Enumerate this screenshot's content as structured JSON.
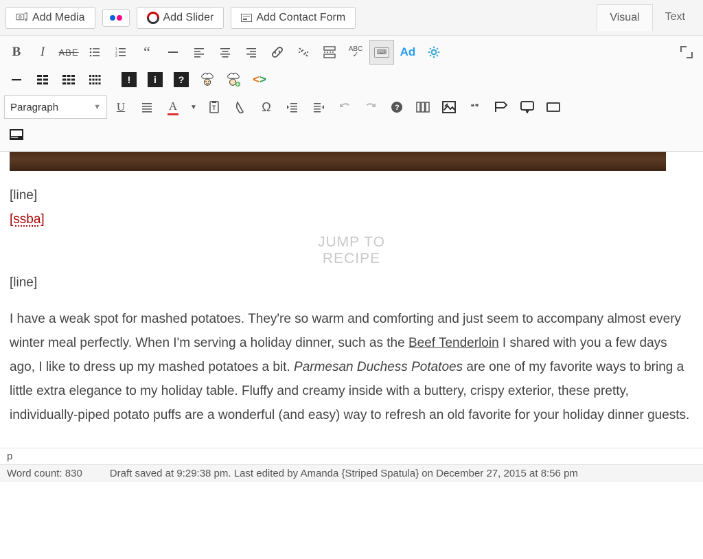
{
  "top_buttons": {
    "add_media": "Add Media",
    "add_slider": "Add Slider",
    "add_form": "Add Contact Form"
  },
  "tabs": {
    "visual": "Visual",
    "text": "Text"
  },
  "format_dropdown": "Paragraph",
  "abc_label": "ABC",
  "ad_label": "Ad",
  "content": {
    "shortcode_line1": "[line]",
    "shortcode_ssba": "[ssba]",
    "jump_line1": "JUMP TO",
    "jump_line2": "RECIPE",
    "shortcode_line2": "[line]",
    "para_prefix": "I have a weak spot for mashed potatoes. They're so warm and comforting and just seem to accompany almost every winter meal perfectly. When I'm serving a holiday dinner, such as the ",
    "link_text": "Beef Tenderloin",
    "para_mid": " I shared with you a few days ago, I like to dress up my mashed potatoes a bit. ",
    "italic_text": "Parmesan Duchess Potatoes",
    "para_suffix": " are one of my favorite ways to bring a little extra elegance to my holiday table. Fluffy and creamy inside with a buttery, crispy exterior, these pretty, individually-piped potato puffs are a wonderful (and easy) way to refresh an old favorite for your holiday dinner guests."
  },
  "path": "p",
  "status": {
    "wordcount_label": "Word count: ",
    "wordcount": "830",
    "autosave": "Draft saved at 9:29:38 pm. Last edited by Amanda {Striped Spatula} on December 27, 2015 at 8:56 pm"
  }
}
